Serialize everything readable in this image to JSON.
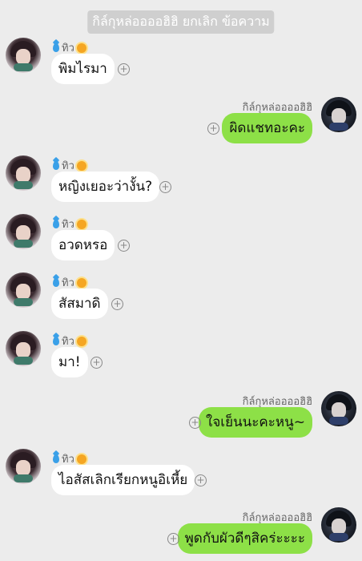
{
  "system_notice": "กิล์กุหล่ออออฮิฮิ ยกเลิก ข้อความ",
  "messages": [
    {
      "side": "left",
      "sender": "ทิว",
      "text": "พิมไรมา"
    },
    {
      "side": "right",
      "sender": "กิล์กุหล่ออออฮิฮิ",
      "text": "ผิดแชทอะคะ"
    },
    {
      "side": "left",
      "sender": "ทิว",
      "text": "หญิงเยอะว่างั้น?"
    },
    {
      "side": "left",
      "sender": "ทิว",
      "text": "อวดหรอ"
    },
    {
      "side": "left",
      "sender": "ทิว",
      "text": "สัสมาดิ"
    },
    {
      "side": "left",
      "sender": "ทิว",
      "text": "มา!"
    },
    {
      "side": "right",
      "sender": "กิล์กุหล่ออออฮิฮิ",
      "text": "ใจเย็นนะคะหนู~"
    },
    {
      "side": "left",
      "sender": "ทิว",
      "text": "ไอสัสเลิกเรียกหนูอิเหี้ย"
    },
    {
      "side": "right",
      "sender": "กิล์กุหล่ออออฮิฮิ",
      "text": "พูดกับผัวดีๆสิคร่ะะะะ"
    }
  ],
  "icons": {
    "left_sender_prefix": "water-drop-icon",
    "left_sender_suffix": "sun-icon",
    "reaction": "add-reaction-icon"
  },
  "colors": {
    "background": "#ececec",
    "incoming_bubble": "#ffffff",
    "outgoing_bubble": "#8de047",
    "notice_bg": "#cfcfcf"
  }
}
